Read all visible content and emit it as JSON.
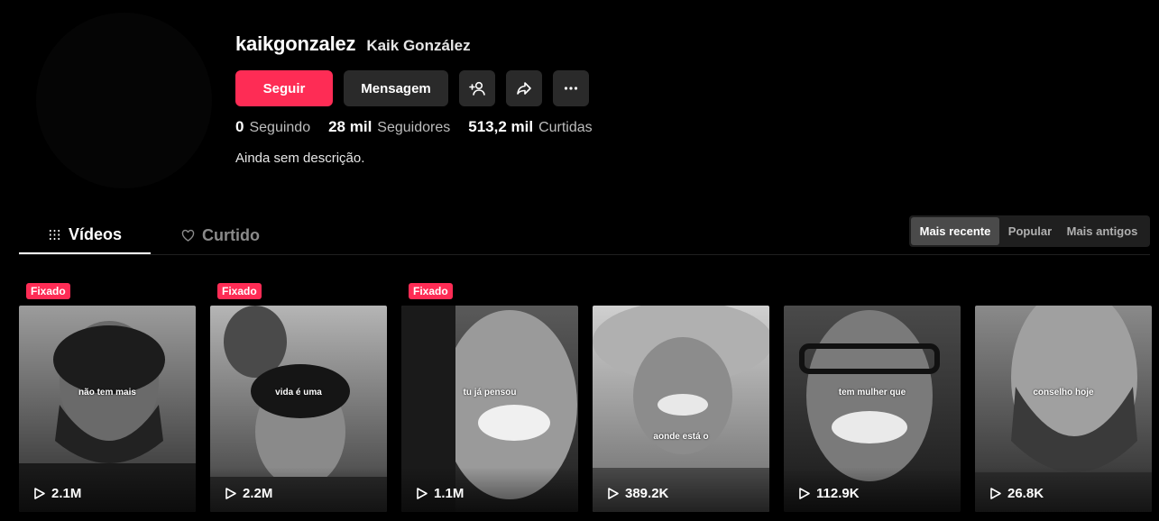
{
  "profile": {
    "username": "kaikgonzalez",
    "display_name": "Kaik González",
    "bio": "Ainda sem descrição."
  },
  "actions": {
    "follow_label": "Seguir",
    "message_label": "Mensagem",
    "add_friend_icon": "person-plus-icon",
    "share_icon": "share-arrow-icon",
    "more_icon": "more-dots-icon"
  },
  "stats": {
    "following_count": "0",
    "following_label": "Seguindo",
    "followers_count": "28 mil",
    "followers_label": "Seguidores",
    "likes_count": "513,2 mil",
    "likes_label": "Curtidas"
  },
  "tabs": {
    "videos_label": "Vídeos",
    "liked_label": "Curtido"
  },
  "sort": {
    "options": [
      "Mais recente",
      "Popular",
      "Mais antigos"
    ],
    "selected": "Mais recente"
  },
  "colors": {
    "accent": "#fe2c55",
    "button_bg": "#2a2a2a"
  },
  "videos": [
    {
      "pinned": true,
      "pin_label": "Fixado",
      "caption": "não tem mais",
      "views": "2.1M"
    },
    {
      "pinned": true,
      "pin_label": "Fixado",
      "caption": "vida é uma",
      "views": "2.2M"
    },
    {
      "pinned": true,
      "pin_label": "Fixado",
      "caption": "tu já pensou",
      "views": "1.1M"
    },
    {
      "pinned": false,
      "caption": "aonde está o",
      "views": "389.2K"
    },
    {
      "pinned": false,
      "caption": "tem mulher que",
      "views": "112.9K"
    },
    {
      "pinned": false,
      "caption": "conselho hoje",
      "views": "26.8K"
    }
  ]
}
